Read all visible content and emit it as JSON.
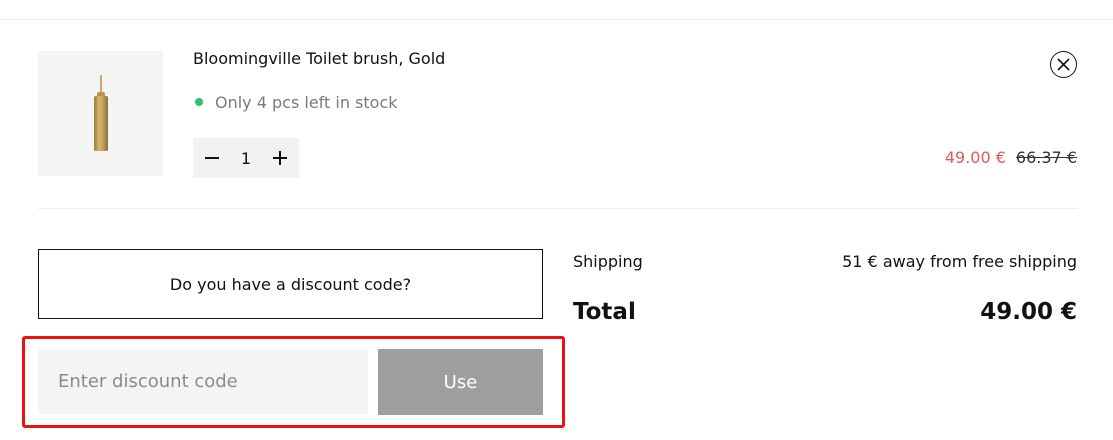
{
  "product": {
    "name": "Bloomingville Toilet brush, Gold",
    "stock_text": "Only 4 pcs left in stock",
    "stock_color": "#2fbf71",
    "quantity": "1",
    "price_sale": "49.00 €",
    "price_original": "66.37 €",
    "sale_color": "#e05a5a",
    "image_icon": "toilet-brush-image",
    "remove_icon": "close-icon",
    "decrease_icon": "minus-icon",
    "increase_icon": "plus-icon"
  },
  "discount": {
    "toggle_label": "Do you have a discount code?",
    "input_value": "",
    "input_placeholder": "Enter discount code",
    "submit_label": "Use",
    "highlight_color": "#ee1111"
  },
  "summary": {
    "shipping_label": "Shipping",
    "shipping_value": "51 € away from free shipping",
    "total_label": "Total",
    "total_value": "49.00 €"
  }
}
